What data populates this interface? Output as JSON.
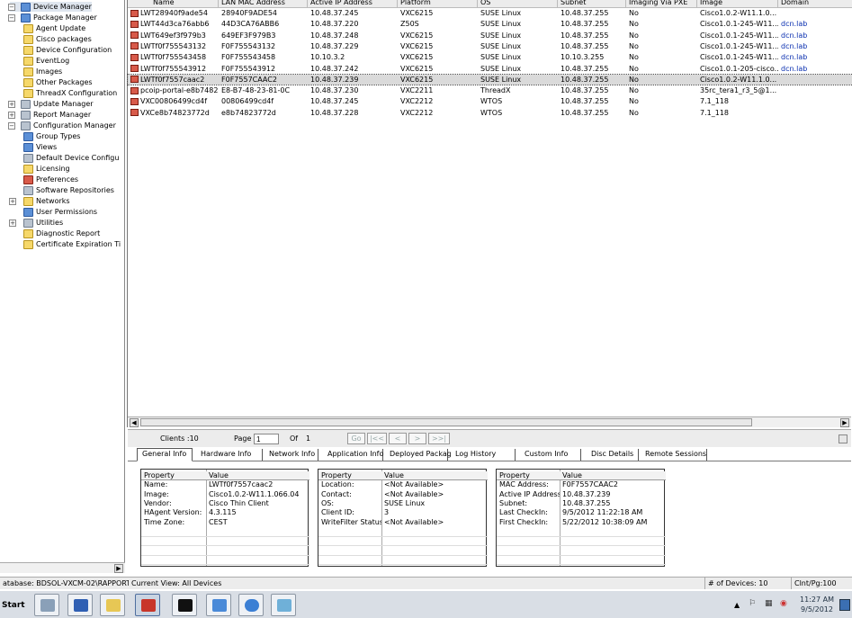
{
  "tree": {
    "items": [
      {
        "label": "Device Manager",
        "indent": 0,
        "exp": "−",
        "icon": "blue",
        "sel": true
      },
      {
        "label": "Package Manager",
        "indent": 0,
        "exp": "−",
        "icon": "blue"
      },
      {
        "label": "Agent Update",
        "indent": 1,
        "icon": "folder"
      },
      {
        "label": "Cisco packages",
        "indent": 1,
        "icon": "folder"
      },
      {
        "label": "Device Configuration",
        "indent": 1,
        "icon": "folder"
      },
      {
        "label": "EventLog",
        "indent": 1,
        "icon": "folder"
      },
      {
        "label": "Images",
        "indent": 1,
        "icon": "folder"
      },
      {
        "label": "Other Packages",
        "indent": 1,
        "icon": "folder"
      },
      {
        "label": "ThreadX Configuration",
        "indent": 1,
        "icon": "folder"
      },
      {
        "label": "Update Manager",
        "indent": 0,
        "exp": "+",
        "icon": "gray"
      },
      {
        "label": "Report Manager",
        "indent": 0,
        "exp": "+",
        "icon": "gray"
      },
      {
        "label": "Configuration Manager",
        "indent": 0,
        "exp": "−",
        "icon": "gray"
      },
      {
        "label": "Group Types",
        "indent": 1,
        "icon": "blue"
      },
      {
        "label": "Views",
        "indent": 1,
        "icon": "blue"
      },
      {
        "label": "Default Device Configu",
        "indent": 1,
        "icon": "gray"
      },
      {
        "label": "Licensing",
        "indent": 1,
        "icon": "folder"
      },
      {
        "label": "Preferences",
        "indent": 1,
        "icon": "red"
      },
      {
        "label": "Software Repositories",
        "indent": 1,
        "icon": "gray"
      },
      {
        "label": "Networks",
        "indent": 1,
        "exp": "+",
        "icon": "folder"
      },
      {
        "label": "User Permissions",
        "indent": 1,
        "icon": "blue"
      },
      {
        "label": "Utilities",
        "indent": 1,
        "exp": "+",
        "icon": "gray"
      },
      {
        "label": "Diagnostic Report",
        "indent": 1,
        "icon": "folder"
      },
      {
        "label": "Certificate Expiration Ti",
        "indent": 1,
        "icon": "folder"
      }
    ]
  },
  "grid": {
    "columns": [
      "Name",
      "LAN MAC Address",
      "Active IP Address",
      "Platform",
      "OS",
      "Subnet",
      "Imaging Via PXE",
      "Image",
      "Domain"
    ],
    "rows": [
      [
        "LWT28940f9ade54",
        "28940F9ADE54",
        "10.48.37.245",
        "VXC6215",
        "SUSE Linux",
        "10.48.37.255",
        "No",
        "Cisco1.0.2-W11.1.0...",
        ""
      ],
      [
        "LWT44d3ca76abb6",
        "44D3CA76ABB6",
        "10.48.37.220",
        "Z50S",
        "SUSE Linux",
        "10.48.37.255",
        "No",
        "Cisco1.0.1-245-W11...",
        "dcn.lab"
      ],
      [
        "LWT649ef3f979b3",
        "649EF3F979B3",
        "10.48.37.248",
        "VXC6215",
        "SUSE Linux",
        "10.48.37.255",
        "No",
        "Cisco1.0.1-245-W11...",
        "dcn.lab"
      ],
      [
        "LWTf0f755543132",
        "F0F755543132",
        "10.48.37.229",
        "VXC6215",
        "SUSE Linux",
        "10.48.37.255",
        "No",
        "Cisco1.0.1-245-W11...",
        "dcn.lab"
      ],
      [
        "LWTf0f755543458",
        "F0F755543458",
        "10.10.3.2",
        "VXC6215",
        "SUSE Linux",
        "10.10.3.255",
        "No",
        "Cisco1.0.1-245-W11...",
        "dcn.lab"
      ],
      [
        "LWTf0f755543912",
        "F0F755543912",
        "10.48.37.242",
        "VXC6215",
        "SUSE Linux",
        "10.48.37.255",
        "No",
        "Cisco1.0.1-205-cisco...",
        "dcn.lab"
      ],
      [
        "LWTf0f7557caac2",
        "F0F7557CAAC2",
        "10.48.37.239",
        "VXC6215",
        "SUSE Linux",
        "10.48.37.255",
        "No",
        "Cisco1.0.2-W11.1.0...",
        ""
      ],
      [
        "pcoip-portal-e8b7482...",
        "E8-B7-48-23-81-0C",
        "10.48.37.230",
        "VXC2211",
        "ThreadX",
        "10.48.37.255",
        "No",
        "35rc_tera1_r3_5@1...",
        ""
      ],
      [
        "VXC00806499cd4f",
        "00806499cd4f",
        "10.48.37.245",
        "VXC2212",
        "WTOS",
        "10.48.37.255",
        "No",
        "7.1_118",
        ""
      ],
      [
        "VXCe8b74823772d",
        "e8b74823772d",
        "10.48.37.228",
        "VXC2212",
        "WTOS",
        "10.48.37.255",
        "No",
        "7.1_118",
        ""
      ]
    ],
    "selected_row": 6
  },
  "pager": {
    "clients": "Clients :10",
    "page_label": "Page",
    "page_value": "1",
    "of_label": "Of",
    "of_value": "1",
    "go": "Go",
    "first": "|<<",
    "prev": "<",
    "next": ">",
    "last": ">>|"
  },
  "tabs": [
    "General Info",
    "Hardware Info",
    "Network Info",
    "Application Info",
    "Deployed Package",
    "Log History",
    "Custom Info",
    "Disc Details",
    "Remote Sessions"
  ],
  "panels": [
    {
      "header": [
        "Property",
        "Value"
      ],
      "rows": [
        [
          "Name:",
          "LWTf0f7557caac2"
        ],
        [
          "Image:",
          "Cisco1.0.2-W11.1.066.04"
        ],
        [
          "Vendor:",
          "Cisco Thin Client"
        ],
        [
          "HAgent Version:",
          "4.3.115"
        ],
        [
          "Time Zone:",
          "CEST"
        ]
      ]
    },
    {
      "header": [
        "Property",
        "Value"
      ],
      "rows": [
        [
          "Location:",
          "<Not Available>"
        ],
        [
          "Contact:",
          "<Not Available>"
        ],
        [
          "OS:",
          "SUSE Linux"
        ],
        [
          "Client ID:",
          "3"
        ],
        [
          "WriteFilter Status:",
          "<Not Available>"
        ]
      ]
    },
    {
      "header": [
        "Property",
        "Value"
      ],
      "rows": [
        [
          "MAC Address:",
          "F0F7557CAAC2"
        ],
        [
          "Active IP Address:",
          "10.48.37.239"
        ],
        [
          "Subnet:",
          "10.48.37.255"
        ],
        [
          "Last CheckIn:",
          "9/5/2012 11:22:18 AM"
        ],
        [
          "First CheckIn:",
          "5/22/2012 10:38:09 AM"
        ]
      ]
    }
  ],
  "status": {
    "database": "atabase: BDSOL-VXCM-02\\RAPPORTDB",
    "view": "Current View: All Devices",
    "devices": "# of Devices: 10",
    "clnt": "Clnt/Pg:100"
  },
  "taskbar": {
    "start": "Start",
    "time": "11:27 AM",
    "date": "9/5/2012"
  }
}
